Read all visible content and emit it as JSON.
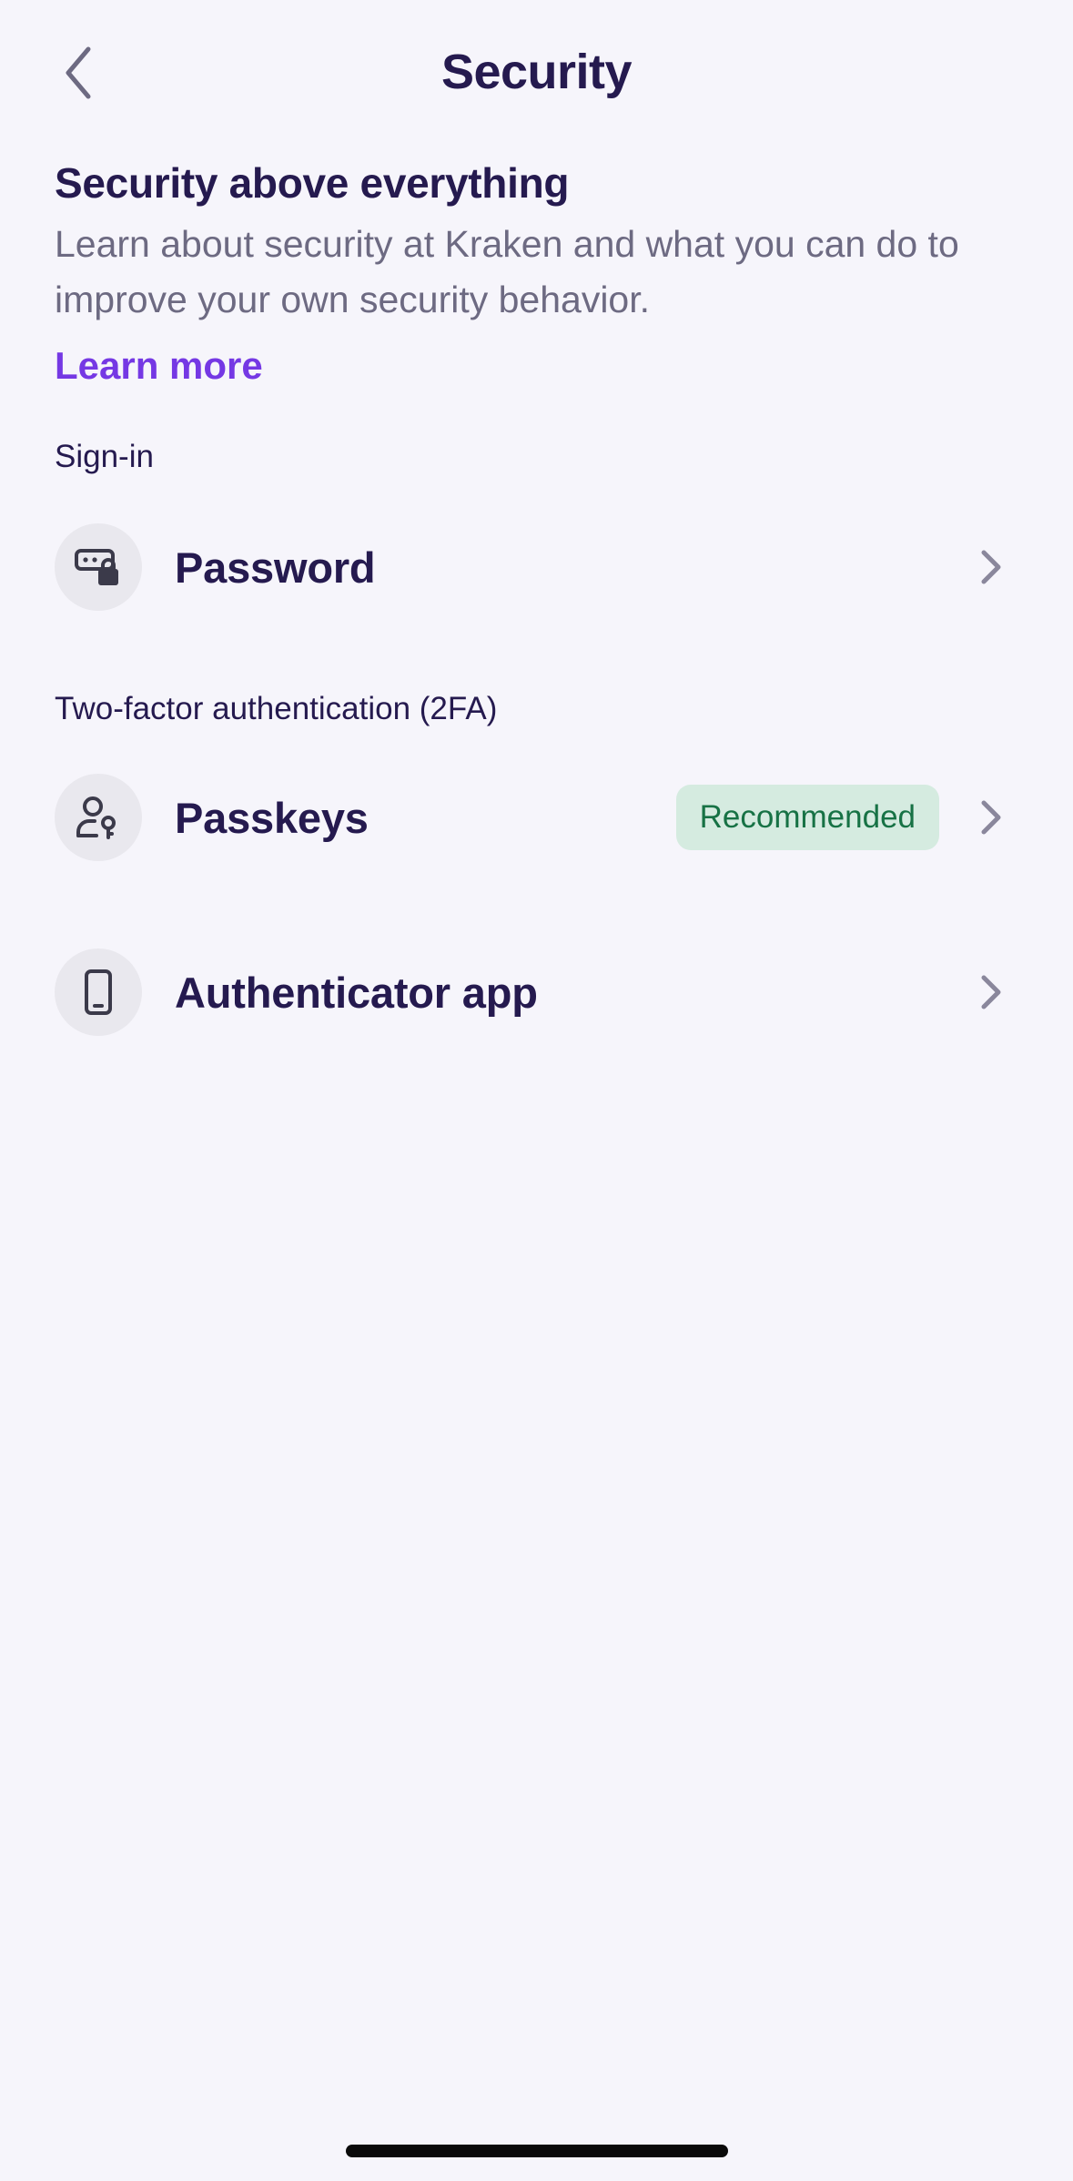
{
  "nav": {
    "title": "Security",
    "back_icon": "chevron-left-icon"
  },
  "intro": {
    "title": "Security above everything",
    "description": "Learn about security at Kraken and what you can do to improve your own security behavior.",
    "link_label": "Learn more"
  },
  "sections": {
    "signin": {
      "label": "Sign-in",
      "items": [
        {
          "label": "Password",
          "icon": "password-lock-icon"
        }
      ]
    },
    "twofa": {
      "label": "Two-factor authentication (2FA)",
      "items": [
        {
          "label": "Passkeys",
          "icon": "user-key-icon",
          "badge": "Recommended"
        },
        {
          "label": "Authenticator app",
          "icon": "phone-icon"
        }
      ]
    }
  },
  "colors": {
    "background": "#f6f5fb",
    "title": "#251a4f",
    "link": "#7538e4",
    "muted": "#6d6a82",
    "badge_bg": "#d5ebe0",
    "badge_text": "#177245"
  }
}
